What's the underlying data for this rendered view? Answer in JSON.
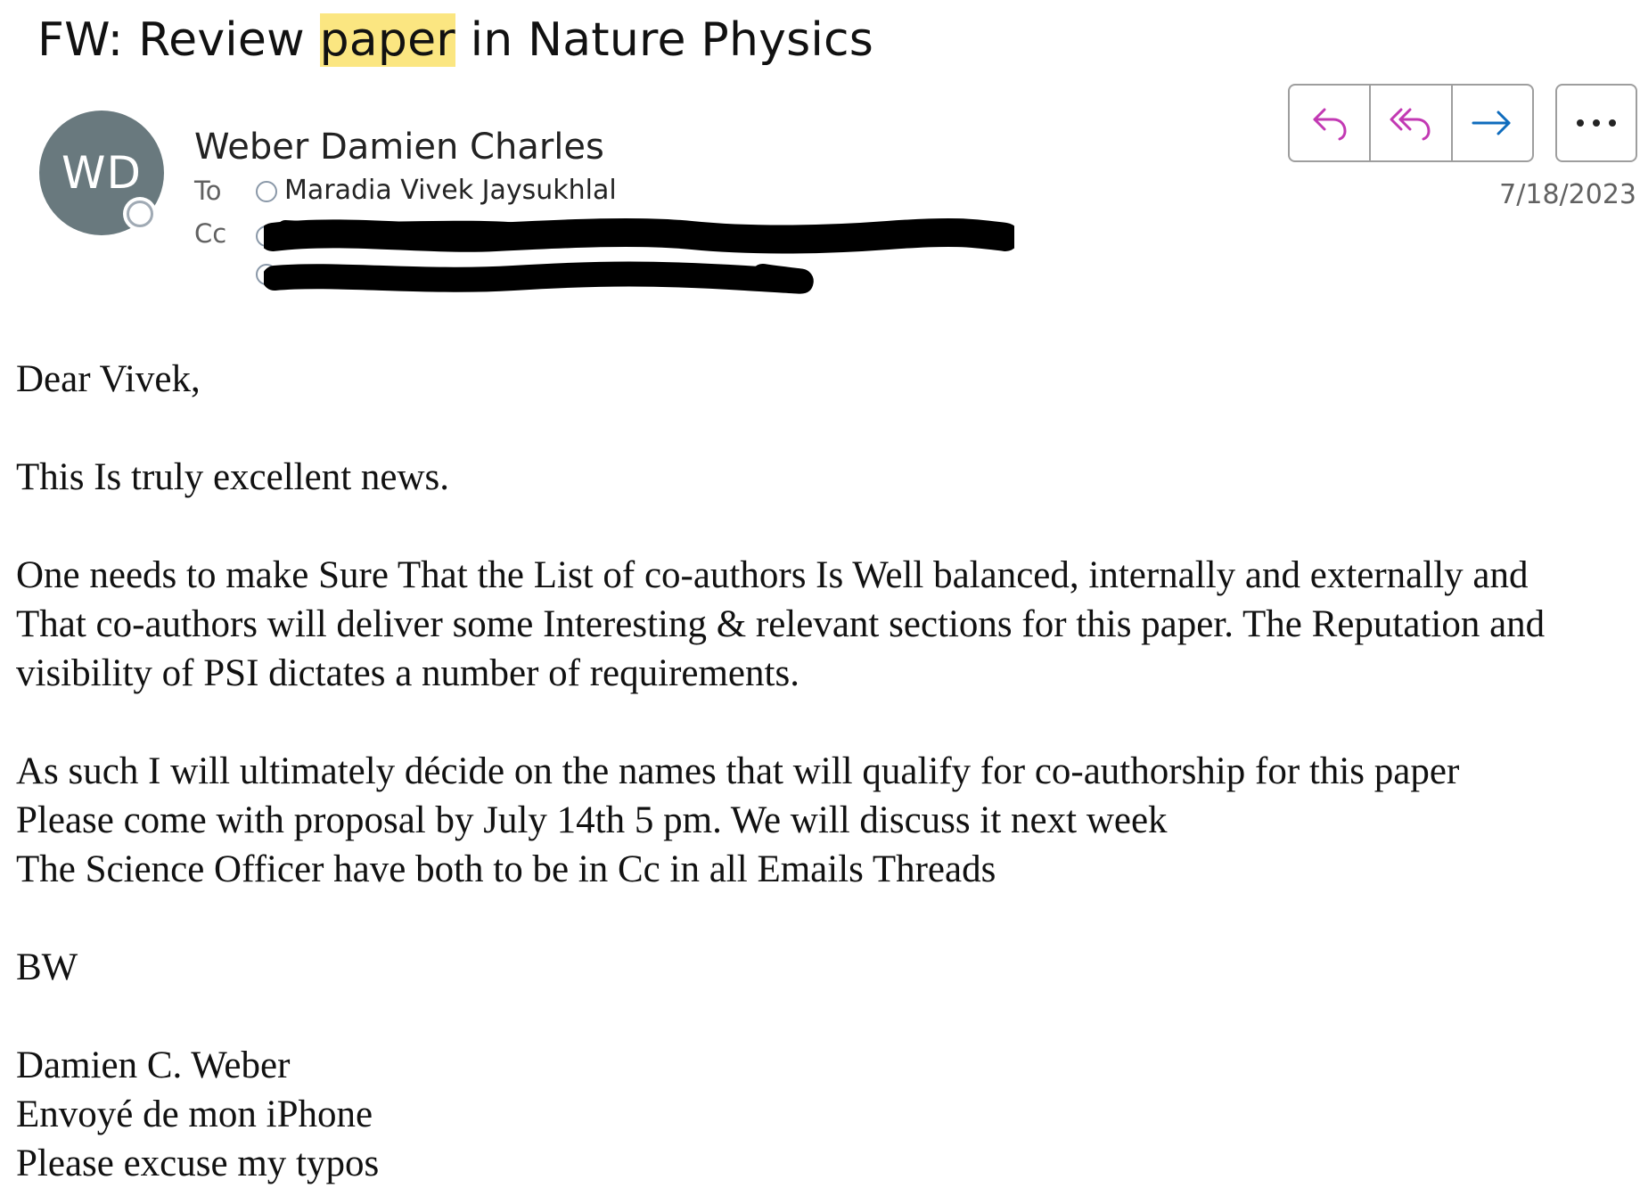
{
  "email": {
    "subject_before": "FW: Review ",
    "subject_highlight": "paper",
    "subject_after": " in Nature Physics",
    "sender_initials": "WD",
    "sender_name": "Weber Damien Charles",
    "to_label": "To",
    "cc_label": "Cc",
    "to_recipients": [
      "Maradia Vivek Jaysukhlal"
    ],
    "date": "7/18/2023",
    "highlight_color": "#fbe681",
    "avatar_color": "#69797e"
  },
  "actions": {
    "reply_icon": "reply-icon",
    "reply_all_icon": "reply-all-icon",
    "forward_icon": "forward-icon",
    "more_icon": "more-icon",
    "reply_color": "#c239b3",
    "forward_color": "#0f6cbd"
  },
  "body": {
    "greeting": "Dear Vivek,",
    "p1": "This Is truly excellent news.",
    "p2_l1": "One needs to make Sure That the List of co-authors Is Well balanced, internally and externally and",
    "p2_l2": "That co-authors will deliver some Interesting & relevant sections for this paper. The Reputation and",
    "p2_l3": "visibility of PSI dictates a number of requirements.",
    "p3_l1": "As such I will ultimately décide on the names that will qualify for co-authorship for this paper",
    "p3_l2": "Please come with proposal by July 14th 5 pm. We will discuss it next week",
    "p3_l3": "The Science Officer have both to be in Cc in all Emails Threads",
    "signoff": "BW",
    "sig_name": "Damien C. Weber",
    "sig_device": "Envoyé de mon iPhone",
    "sig_typos": "Please excuse my typos"
  }
}
